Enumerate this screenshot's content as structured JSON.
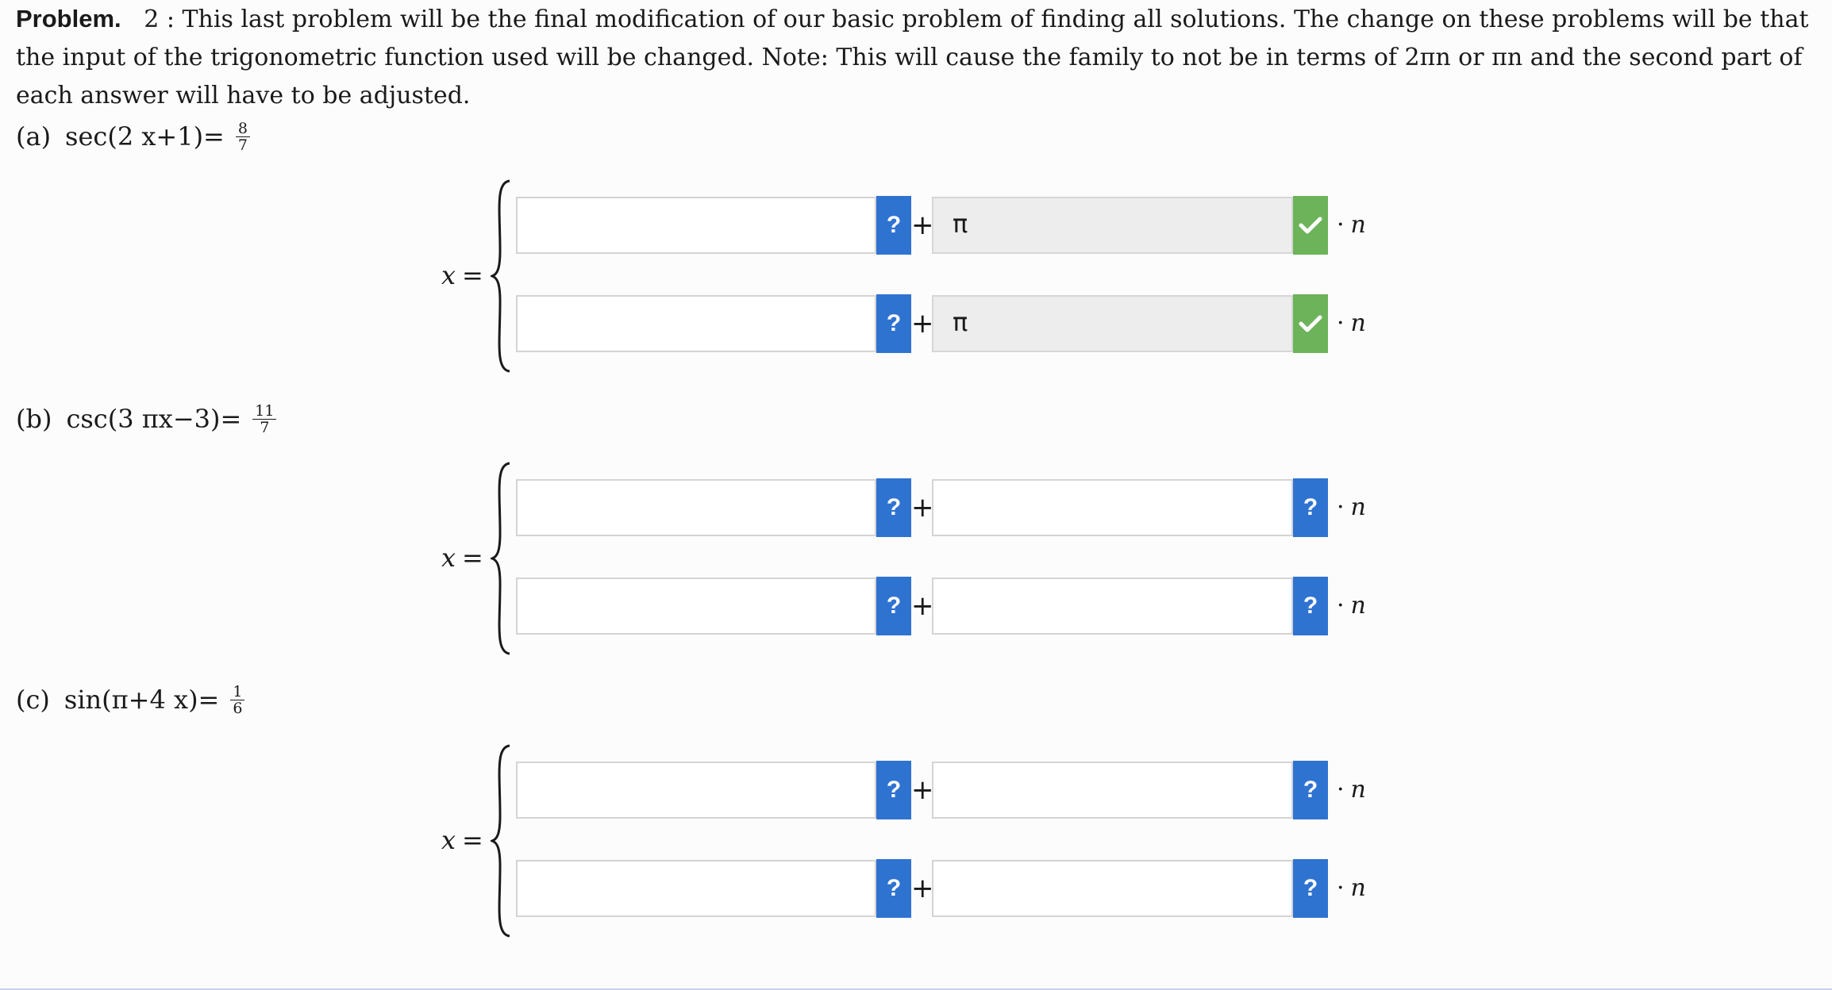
{
  "problem": {
    "lead": "Problem.",
    "number": "2 :",
    "text": "This last problem will be the final modification of our basic problem of finding all solutions. The change on these problems will be that the input of the trigonometric function used will be changed. Note: This will cause the family to not be in terms of 2πn or πn and the second part of each answer will have to be adjusted."
  },
  "parts": [
    {
      "label": "(a)",
      "func": "sec(2 x+1)=",
      "num": "8",
      "den": "7",
      "x_label": "x",
      "eq": "=",
      "rows": [
        {
          "first_value": "",
          "second_value": "π",
          "second_state": "correct",
          "times": "·",
          "n": "n"
        },
        {
          "first_value": "",
          "second_value": "π",
          "second_state": "correct",
          "times": "·",
          "n": "n"
        }
      ]
    },
    {
      "label": "(b)",
      "func": "csc(3 πx−3)=",
      "num": "11",
      "den": "7",
      "x_label": "x",
      "eq": "=",
      "rows": [
        {
          "first_value": "",
          "second_value": "",
          "second_state": "unanswered",
          "times": "·",
          "n": "n"
        },
        {
          "first_value": "",
          "second_value": "",
          "second_state": "unanswered",
          "times": "·",
          "n": "n"
        }
      ]
    },
    {
      "label": "(c)",
      "func": "sin(π+4 x)=",
      "num": "1",
      "den": "6",
      "x_label": "x",
      "eq": "=",
      "rows": [
        {
          "first_value": "",
          "second_value": "",
          "second_state": "unanswered",
          "times": "·",
          "n": "n"
        },
        {
          "first_value": "",
          "second_value": "",
          "second_state": "unanswered",
          "times": "·",
          "n": "n"
        }
      ]
    }
  ],
  "help_button_label": "?",
  "plus_sign": "+",
  "icons": {
    "help": "question-mark-icon",
    "correct": "checkmark-icon",
    "brace": "left-brace-icon"
  },
  "colors": {
    "help_button": "#2f73d1",
    "correct_button": "#6cb35a",
    "locked_field": "#ededee"
  }
}
